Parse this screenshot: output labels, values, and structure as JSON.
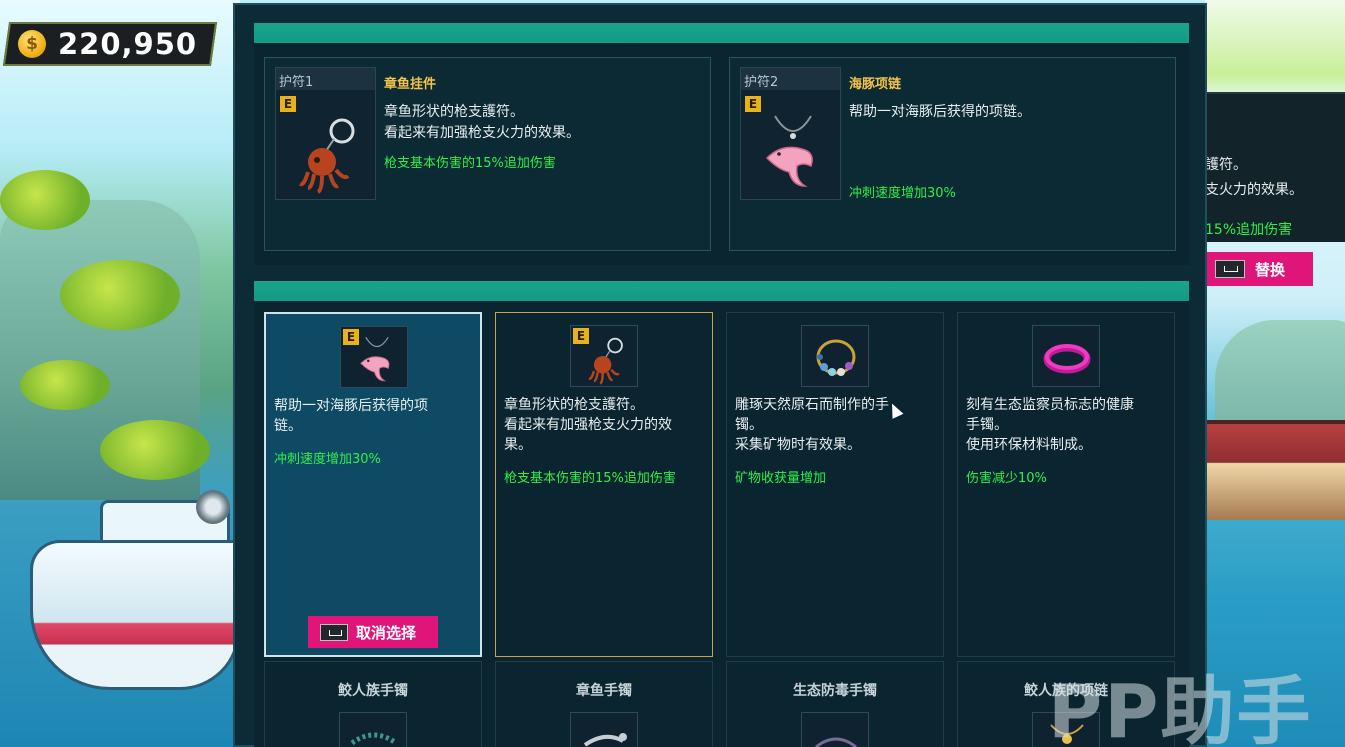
{
  "currency": {
    "icon": "coin-icon",
    "symbol": "$",
    "amount": "220,950"
  },
  "equipped": {
    "slots": [
      {
        "slot_label": "护符1",
        "badge": "E",
        "name": "章鱼挂件",
        "description": "章鱼形状的枪支護符。\n看起来有加强枪支火力的效果。",
        "effect": "枪支基本伤害的15%追加伤害",
        "icon": "octopus-charm-icon"
      },
      {
        "slot_label": "护符2",
        "badge": "E",
        "name": "海豚项链",
        "description": "帮助一对海豚后获得的项链。",
        "effect": "冲刺速度增加30%",
        "icon": "dolphin-necklace-icon"
      }
    ]
  },
  "inventory": {
    "cards": [
      {
        "badge": "E",
        "icon": "dolphin-necklace-icon",
        "description": "帮助一对海豚后获得的项\n链。",
        "effect": "冲刺速度增加30%",
        "state": "selected"
      },
      {
        "badge": "E",
        "icon": "octopus-charm-icon",
        "description": "章鱼形状的枪支護符。\n看起来有加强枪支火力的效\n果。",
        "effect": "枪支基本伤害的15%追加伤害",
        "state": "hover"
      },
      {
        "badge": "",
        "icon": "stone-bracelet-icon",
        "description": "雕琢天然原石而制作的手\n镯。\n采集矿物时有效果。",
        "effect": "矿物收获量增加",
        "state": "normal"
      },
      {
        "badge": "",
        "icon": "eco-wristband-icon",
        "description": "刻有生态监察员标志的健康\n手镯。\n使用环保材料制成。",
        "effect": "伤害减少10%",
        "state": "normal"
      }
    ],
    "second_row": [
      {
        "name": "鲛人族手镯",
        "icon": "beaded-bracelet-icon"
      },
      {
        "name": "章鱼手镯",
        "icon": "octopus-bracelet-icon"
      },
      {
        "name": "生态防毒手镯",
        "icon": "antidote-bracelet-icon"
      },
      {
        "name": "鲛人族的项链",
        "icon": "merfolk-necklace-icon"
      }
    ],
    "cancel_label": "取消选择",
    "key_icon": "spacebar-key-icon"
  },
  "peek_panel": {
    "line1": "護符。",
    "line2": "支火力的效果。",
    "line3": "15%追加伤害",
    "replace_label": "替换"
  },
  "watermark": "PP助手",
  "colors": {
    "accent_green": "#2df04a",
    "item_name_gold": "#f5c24a",
    "button_pink": "#e0157a",
    "header_teal": "#1aa48e",
    "panel_bg": "#0c2b36"
  }
}
